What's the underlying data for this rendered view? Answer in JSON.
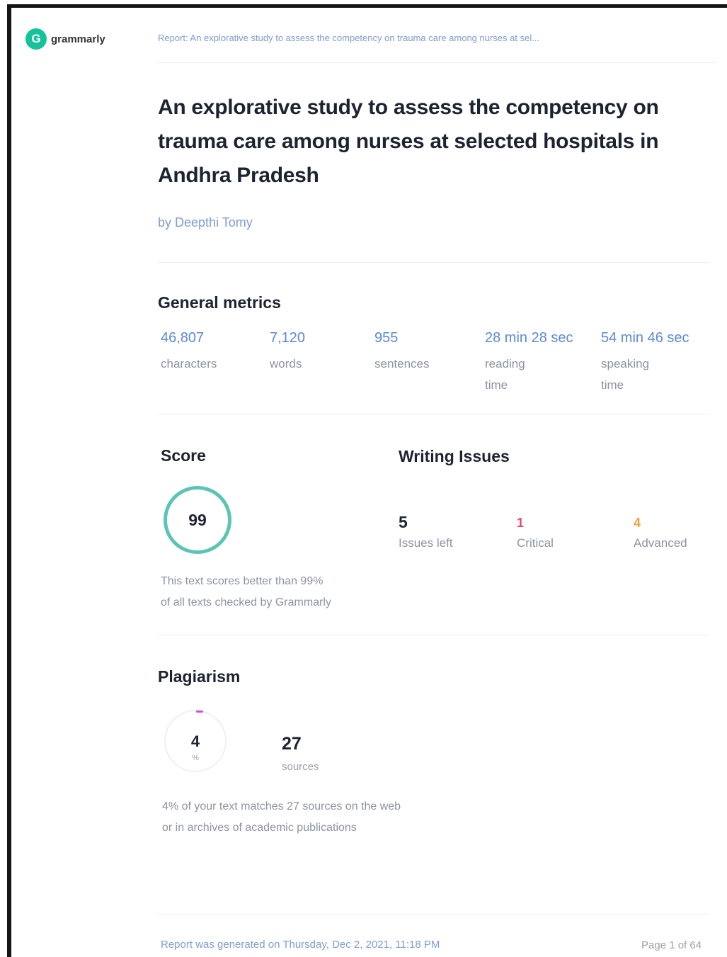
{
  "brand": {
    "logo_letter": "G",
    "name": "grammarly",
    "brand_color": "#15c39a"
  },
  "header": {
    "report_line": "Report: An explorative study to assess the competency on trauma care among nurses at sel..."
  },
  "document": {
    "title": "An explorative study to assess the competency on trauma care among nurses at selected hospitals in Andhra Pradesh",
    "author": "by Deepthi Tomy"
  },
  "general_metrics": {
    "heading": "General metrics",
    "items": [
      {
        "value": "46,807",
        "label": "characters"
      },
      {
        "value": "7,120",
        "label": "words"
      },
      {
        "value": "955",
        "label": "sentences"
      },
      {
        "value": "28 min 28 sec",
        "label": "reading time"
      },
      {
        "value": "54 min 46 sec",
        "label": "speaking time"
      }
    ]
  },
  "score": {
    "heading": "Score",
    "value": "99",
    "note_line1": "This text scores better than 99%",
    "note_line2": "of all texts checked by Grammarly",
    "ring_color": "#5cc4b6"
  },
  "writing_issues": {
    "heading": "Writing Issues",
    "items": [
      {
        "value": "5",
        "label": "Issues left",
        "color": "#1d2331"
      },
      {
        "value": "1",
        "label": "Critical",
        "color": "#e8476a"
      },
      {
        "value": "4",
        "label": "Advanced",
        "color": "#f1a23b"
      }
    ]
  },
  "plagiarism": {
    "heading": "Plagiarism",
    "percent": "4",
    "percent_unit": "%",
    "sources_value": "27",
    "sources_label": "sources",
    "note_line1": "4% of your text matches 27 sources on the web",
    "note_line2": "or in archives of academic publications",
    "arc_color": "#dd4bcf"
  },
  "footer": {
    "generated": "Report was generated on Thursday, Dec 2, 2021, 11:18 PM",
    "page": "Page 1 of 64"
  }
}
